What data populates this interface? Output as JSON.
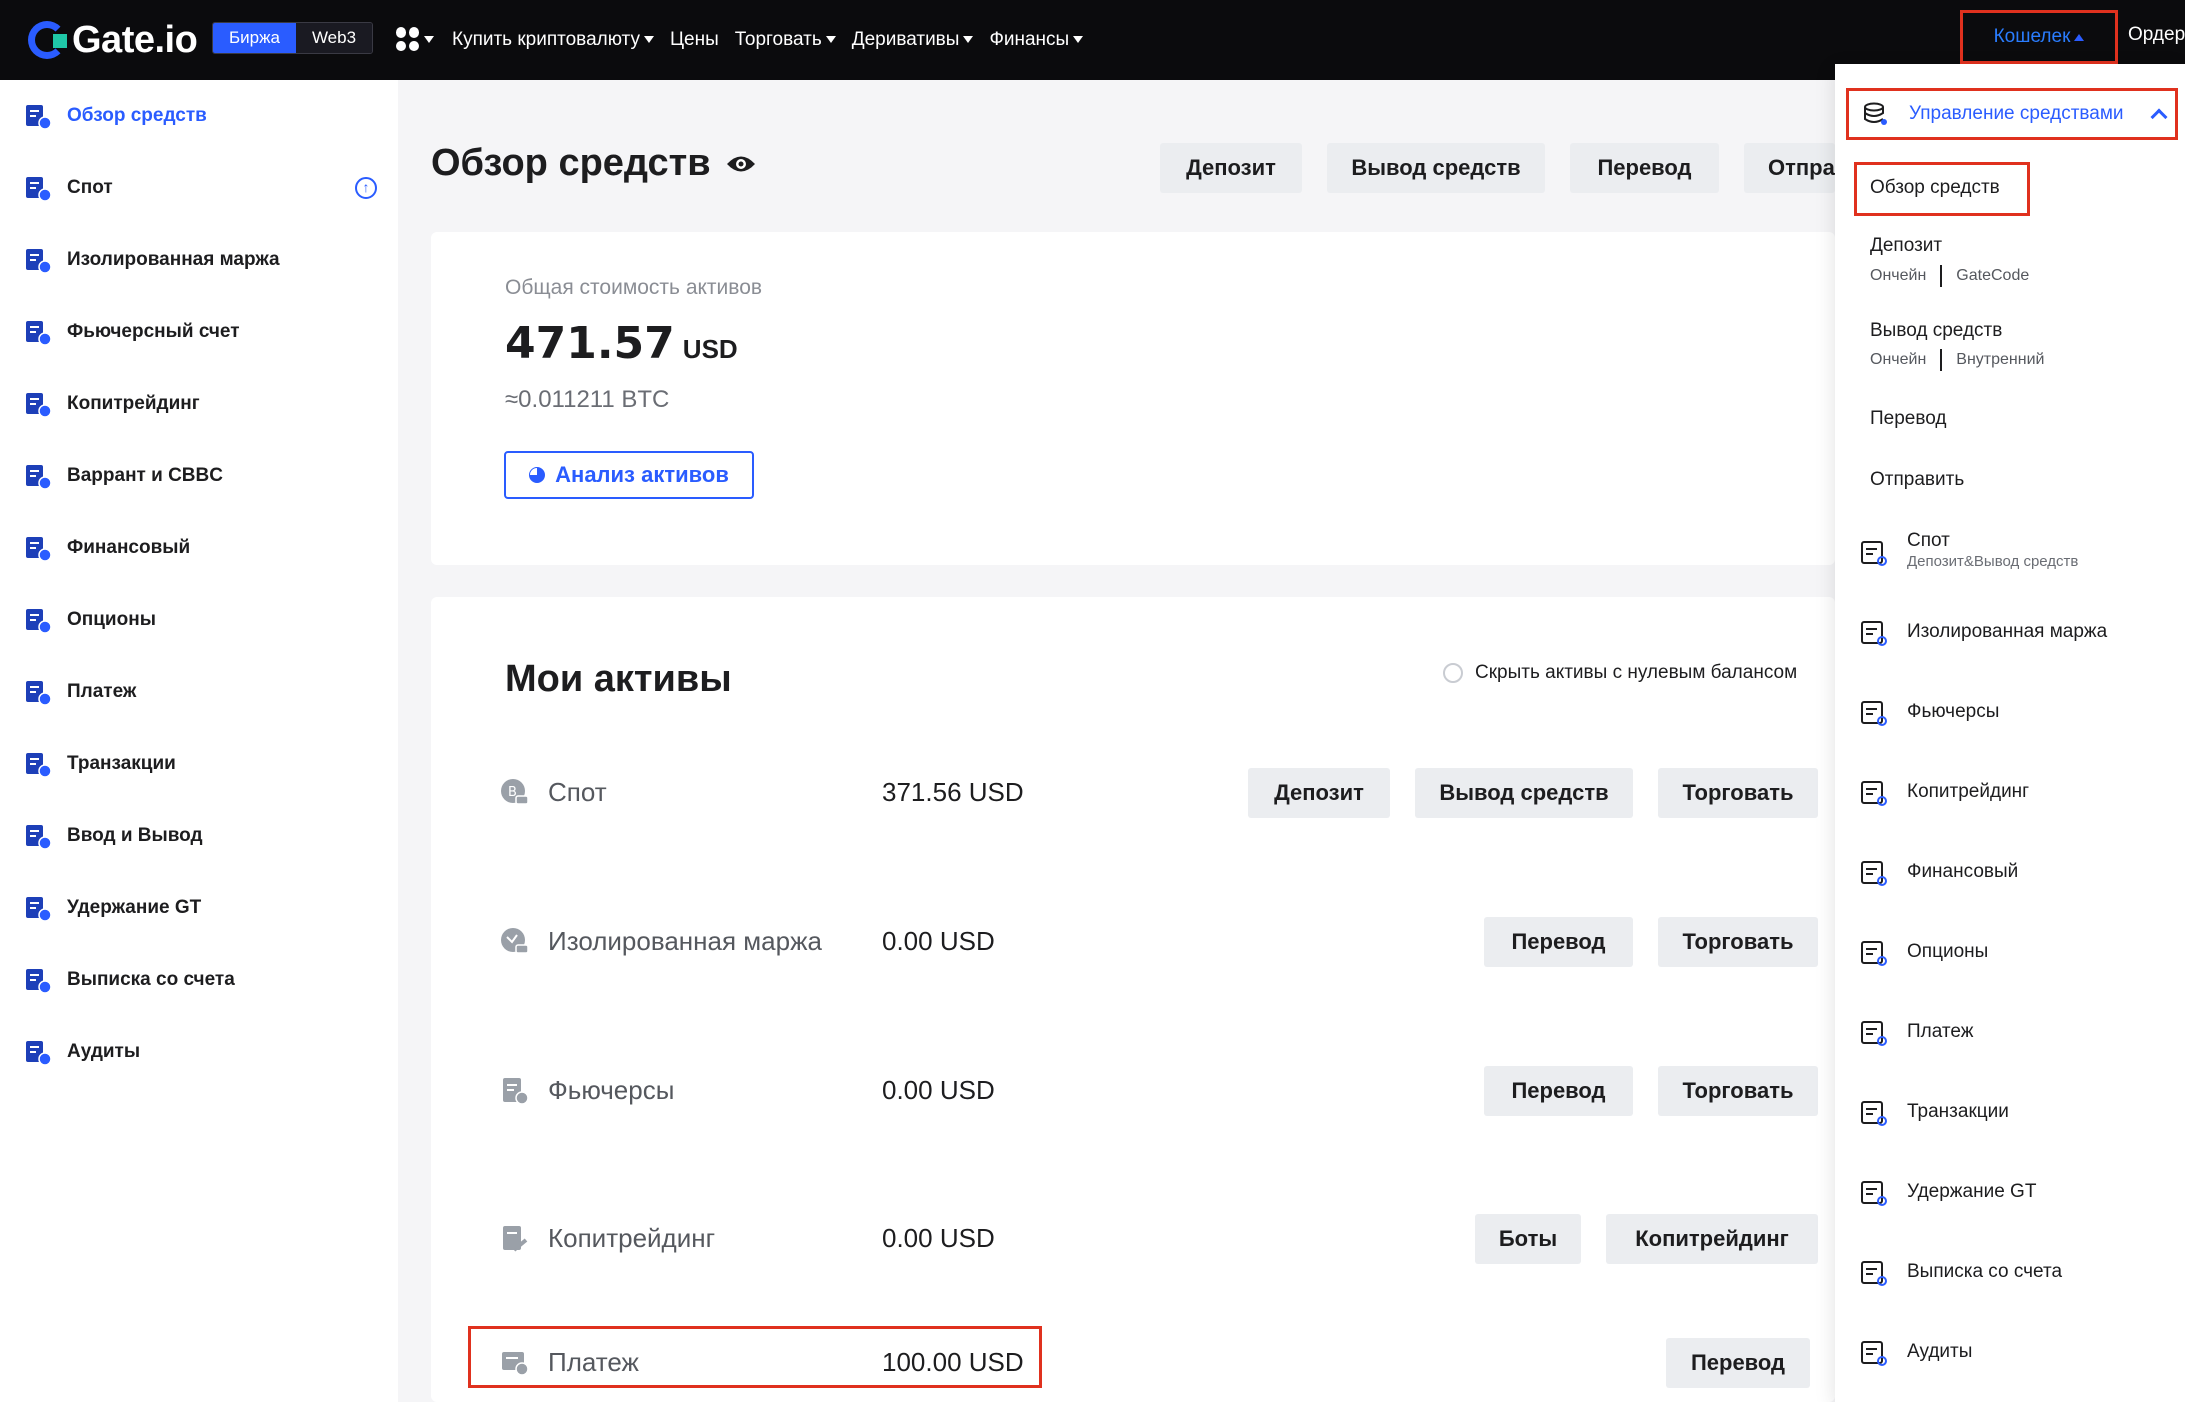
{
  "topnav": {
    "logo": "Gate.io",
    "seg_exchange": "Биржа",
    "seg_web3": "Web3",
    "items": [
      "Купить криптовалюту",
      "Цены",
      "Торговать",
      "Деривативы",
      "Финансы"
    ],
    "wallet": "Кошелек",
    "orders": "Ордер"
  },
  "sidebar": {
    "items": [
      {
        "label": "Обзор средств",
        "icon": "user-wallet-icon"
      },
      {
        "label": "Спот",
        "icon": "spot-icon"
      },
      {
        "label": "Изолированная маржа",
        "icon": "margin-icon"
      },
      {
        "label": "Фьючерсный счет",
        "icon": "futures-icon"
      },
      {
        "label": "Копитрейдинг",
        "icon": "copytrading-icon"
      },
      {
        "label": "Варрант и CBBC",
        "icon": "warrant-icon"
      },
      {
        "label": "Финансовый",
        "icon": "finance-icon"
      },
      {
        "label": "Опционы",
        "icon": "options-icon"
      },
      {
        "label": "Платеж",
        "icon": "payment-icon"
      },
      {
        "label": "Транзакции",
        "icon": "transactions-icon"
      },
      {
        "label": "Ввод и Вывод",
        "icon": "deposit-withdraw-icon"
      },
      {
        "label": "Удержание GT",
        "icon": "gt-holding-icon"
      },
      {
        "label": "Выписка со счета",
        "icon": "statement-icon"
      },
      {
        "label": "Аудиты",
        "icon": "audit-icon"
      }
    ],
    "spot_badge": "↑"
  },
  "main": {
    "title": "Обзор средств",
    "actions": [
      "Депозит",
      "Вывод средств",
      "Перевод",
      "Отправи"
    ],
    "total_label": "Общая стоимость активов",
    "total_value": "471.57",
    "total_currency": "USD",
    "total_btc": "≈0.011211 BTC",
    "analysis_button": "Анализ активов",
    "assets_title": "Мои активы",
    "hide_zero": "Скрыть активы с нулевым балансом",
    "assets": [
      {
        "name": "Спот",
        "value": "371.56 USD",
        "buttons": [
          "Депозит",
          "Вывод средств",
          "Торговать"
        ]
      },
      {
        "name": "Изолированная маржа",
        "value": "0.00 USD",
        "buttons": [
          "Перевод",
          "Торговать"
        ]
      },
      {
        "name": "Фьючерсы",
        "value": "0.00 USD",
        "buttons": [
          "Перевод",
          "Торговать"
        ]
      },
      {
        "name": "Копитрейдинг",
        "value": "0.00 USD",
        "buttons": [
          "Боты",
          "Копитрейдинг"
        ]
      },
      {
        "name": "Платеж",
        "value": "100.00 USD",
        "buttons": [
          "Перевод"
        ]
      }
    ]
  },
  "dropdown": {
    "header": "Управление средствами",
    "overview": "Обзор средств",
    "deposit": "Депозит",
    "deposit_links": [
      "Ончейн",
      "GateCode"
    ],
    "withdraw": "Вывод средств",
    "withdraw_links": [
      "Ончейн",
      "Внутренний"
    ],
    "transfer": "Перевод",
    "send": "Отправить",
    "accounts": [
      {
        "label": "Спот",
        "sub": "Депозит&Вывод средств"
      },
      {
        "label": "Изолированная маржа"
      },
      {
        "label": "Фьючерсы"
      },
      {
        "label": "Копитрейдинг"
      },
      {
        "label": "Финансовый"
      },
      {
        "label": "Опционы"
      },
      {
        "label": "Платеж"
      },
      {
        "label": "Транзакции"
      },
      {
        "label": "Удержание GT"
      },
      {
        "label": "Выписка со счета"
      },
      {
        "label": "Аудиты"
      }
    ]
  },
  "colors": {
    "accent": "#2a5cff",
    "highlight": "#e0311e",
    "nav_bg": "#0b0b0d"
  }
}
